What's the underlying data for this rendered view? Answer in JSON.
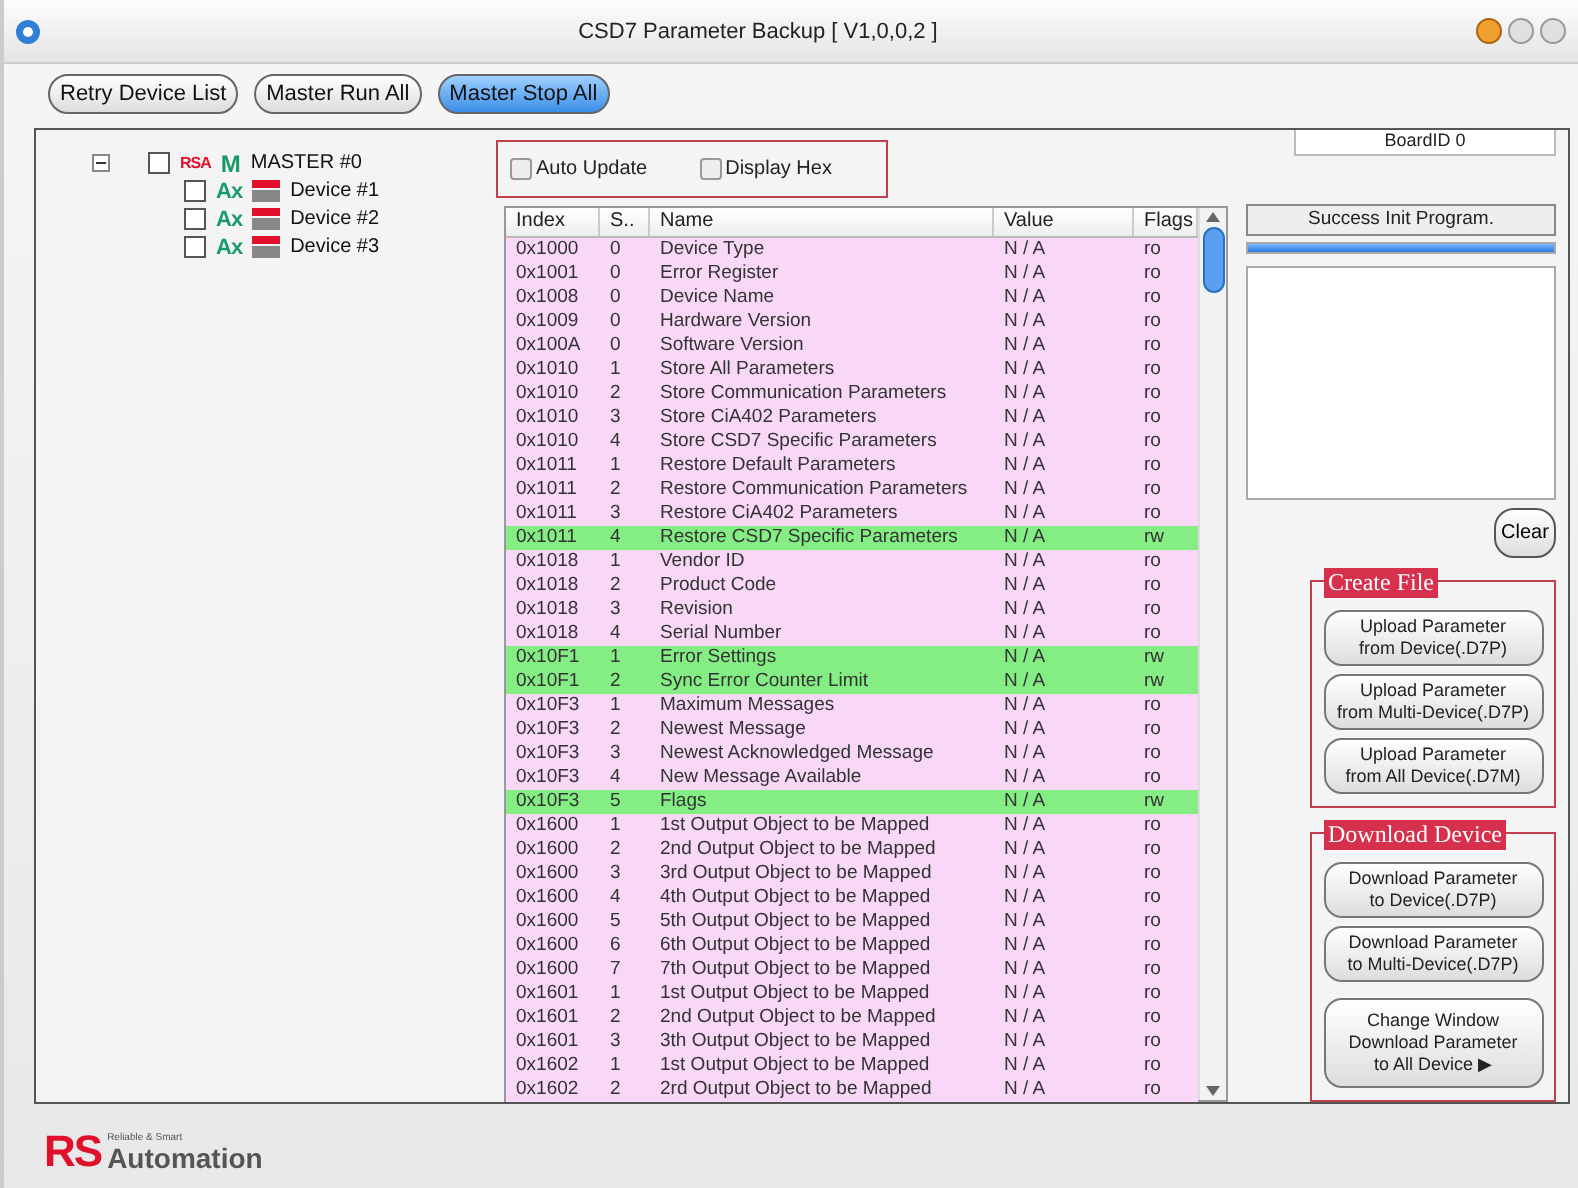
{
  "window": {
    "title": "CSD7 Parameter Backup [ V1,0,0,2 ]"
  },
  "toolbar": [
    {
      "label": "Retry Device List",
      "active": false
    },
    {
      "label": "Master Run All",
      "active": false
    },
    {
      "label": "Master Stop All",
      "active": true
    }
  ],
  "tree": {
    "label": "MASTER #0",
    "badge": "RSA",
    "letter": "M",
    "expanded": true,
    "checked": false,
    "children": [
      {
        "label": "Device #1",
        "badge": "Ax",
        "checked": false
      },
      {
        "label": "Device #2",
        "badge": "Ax",
        "checked": false
      },
      {
        "label": "Device #3",
        "badge": "Ax",
        "checked": false
      }
    ]
  },
  "options": [
    {
      "label": "Auto Update",
      "checked": false
    },
    {
      "label": "Display Hex",
      "checked": false
    }
  ],
  "table": {
    "columns": [
      "Index",
      "S..",
      "Name",
      "Value",
      "Flags"
    ],
    "rows": [
      {
        "cells": [
          "0x1000",
          "0",
          "Device Type",
          "N / A",
          "ro"
        ],
        "color": "#f8d8f6"
      },
      {
        "cells": [
          "0x1001",
          "0",
          "Error Register",
          "N / A",
          "ro"
        ],
        "color": "#f8d8f6"
      },
      {
        "cells": [
          "0x1008",
          "0",
          "Device Name",
          "N / A",
          "ro"
        ],
        "color": "#f8d8f6"
      },
      {
        "cells": [
          "0x1009",
          "0",
          "Hardware Version",
          "N / A",
          "ro"
        ],
        "color": "#f8d8f6"
      },
      {
        "cells": [
          "0x100A",
          "0",
          "Software Version",
          "N / A",
          "ro"
        ],
        "color": "#f8d8f6"
      },
      {
        "cells": [
          "0x1010",
          "1",
          "Store All Parameters",
          "N / A",
          "ro"
        ],
        "color": "#f8d8f6"
      },
      {
        "cells": [
          "0x1010",
          "2",
          "Store Communication Parameters",
          "N / A",
          "ro"
        ],
        "color": "#f8d8f6"
      },
      {
        "cells": [
          "0x1010",
          "3",
          "Store CiA402 Parameters",
          "N / A",
          "ro"
        ],
        "color": "#f8d8f6"
      },
      {
        "cells": [
          "0x1010",
          "4",
          "Store CSD7 Specific Parameters",
          "N / A",
          "ro"
        ],
        "color": "#f8d8f6"
      },
      {
        "cells": [
          "0x1011",
          "1",
          "Restore Default Parameters",
          "N / A",
          "ro"
        ],
        "color": "#f8d8f6"
      },
      {
        "cells": [
          "0x1011",
          "2",
          "Restore Communication Parameters",
          "N / A",
          "ro"
        ],
        "color": "#f8d8f6"
      },
      {
        "cells": [
          "0x1011",
          "3",
          "Restore CiA402 Parameters",
          "N / A",
          "ro"
        ],
        "color": "#f8d8f6"
      },
      {
        "cells": [
          "0x1011",
          "4",
          "Restore CSD7 Specific Parameters",
          "N / A",
          "rw"
        ],
        "color": "#84ee84"
      },
      {
        "cells": [
          "0x1018",
          "1",
          "Vendor ID",
          "N / A",
          "ro"
        ],
        "color": "#f8d8f6"
      },
      {
        "cells": [
          "0x1018",
          "2",
          "Product Code",
          "N / A",
          "ro"
        ],
        "color": "#f8d8f6"
      },
      {
        "cells": [
          "0x1018",
          "3",
          "Revision",
          "N / A",
          "ro"
        ],
        "color": "#f8d8f6"
      },
      {
        "cells": [
          "0x1018",
          "4",
          "Serial Number",
          "N / A",
          "ro"
        ],
        "color": "#f8d8f6"
      },
      {
        "cells": [
          "0x10F1",
          "1",
          "Error Settings",
          "N / A",
          "rw"
        ],
        "color": "#84ee84"
      },
      {
        "cells": [
          "0x10F1",
          "2",
          "Sync Error Counter Limit",
          "N / A",
          "rw"
        ],
        "color": "#84ee84"
      },
      {
        "cells": [
          "0x10F3",
          "1",
          "Maximum Messages",
          "N / A",
          "ro"
        ],
        "color": "#f8d8f6"
      },
      {
        "cells": [
          "0x10F3",
          "2",
          "Newest Message",
          "N / A",
          "ro"
        ],
        "color": "#f8d8f6"
      },
      {
        "cells": [
          "0x10F3",
          "3",
          "Newest Acknowledged Message",
          "N / A",
          "ro"
        ],
        "color": "#f8d8f6"
      },
      {
        "cells": [
          "0x10F3",
          "4",
          "New Message Available",
          "N / A",
          "ro"
        ],
        "color": "#f8d8f6"
      },
      {
        "cells": [
          "0x10F3",
          "5",
          "Flags",
          "N / A",
          "rw"
        ],
        "color": "#84ee84"
      },
      {
        "cells": [
          "0x1600",
          "1",
          "1st Output Object to be Mapped",
          "N / A",
          "ro"
        ],
        "color": "#f8d8f6"
      },
      {
        "cells": [
          "0x1600",
          "2",
          "2nd Output Object to be Mapped",
          "N / A",
          "ro"
        ],
        "color": "#f8d8f6"
      },
      {
        "cells": [
          "0x1600",
          "3",
          "3rd Output Object to be Mapped",
          "N / A",
          "ro"
        ],
        "color": "#f8d8f6"
      },
      {
        "cells": [
          "0x1600",
          "4",
          "4th Output Object to be Mapped",
          "N / A",
          "ro"
        ],
        "color": "#f8d8f6"
      },
      {
        "cells": [
          "0x1600",
          "5",
          "5th Output Object to be Mapped",
          "N / A",
          "ro"
        ],
        "color": "#f8d8f6"
      },
      {
        "cells": [
          "0x1600",
          "6",
          "6th Output Object to be Mapped",
          "N / A",
          "ro"
        ],
        "color": "#f8d8f6"
      },
      {
        "cells": [
          "0x1600",
          "7",
          "7th Output Object to be Mapped",
          "N / A",
          "ro"
        ],
        "color": "#f8d8f6"
      },
      {
        "cells": [
          "0x1601",
          "1",
          "1st Output Object to be Mapped",
          "N / A",
          "ro"
        ],
        "color": "#f8d8f6"
      },
      {
        "cells": [
          "0x1601",
          "2",
          "2nd Output Object to be Mapped",
          "N / A",
          "ro"
        ],
        "color": "#f8d8f6"
      },
      {
        "cells": [
          "0x1601",
          "3",
          "3th Output Object to be Mapped",
          "N / A",
          "ro"
        ],
        "color": "#f8d8f6"
      },
      {
        "cells": [
          "0x1602",
          "1",
          "1st Output Object to be Mapped",
          "N / A",
          "ro"
        ],
        "color": "#f8d8f6"
      },
      {
        "cells": [
          "0x1602",
          "2",
          "2rd Output Object to be Mapped",
          "N / A",
          "ro"
        ],
        "color": "#f8d8f6"
      }
    ]
  },
  "board_id": "BoardID 0",
  "status": {
    "message": "Success Init Program.",
    "level": 1
  },
  "clear_button": "Clear",
  "groups": [
    {
      "title": "Create File",
      "buttons": [
        [
          "Upload Parameter",
          "from Device(.D7P)"
        ],
        [
          "Upload Parameter",
          "from Multi-Device(.D7P)"
        ],
        [
          "Upload Parameter",
          "from All Device(.D7M)"
        ]
      ]
    },
    {
      "title": "Download Device",
      "buttons": [
        [
          "Download Parameter",
          "to Device(.D7P)"
        ],
        [
          "Download Parameter",
          "to Multi-Device(.D7P)"
        ],
        [
          "Change Window",
          "Download Parameter",
          "to All Device ▶"
        ]
      ]
    }
  ],
  "brand": {
    "mark": "RS",
    "tagline": "Reliable & Smart",
    "name": "Automation"
  }
}
